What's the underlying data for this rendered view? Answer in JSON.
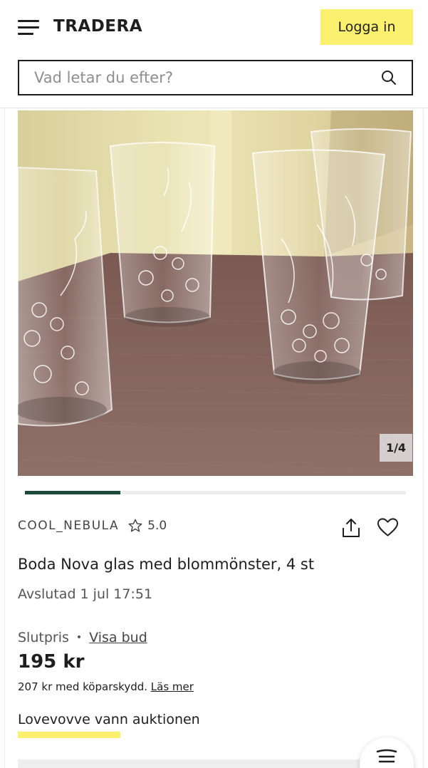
{
  "header": {
    "logo": "TRADERA",
    "login_label": "Logga in",
    "search_placeholder": "Vad letar du efter?"
  },
  "gallery": {
    "counter": "1/4",
    "progress": 0.25
  },
  "listing": {
    "seller": "COOL_NEBULA",
    "rating": "5.0",
    "title": "Boda Nova glas med blommönster, 4 st",
    "ended": "Avslutad 1 jul 17:51",
    "price_label": "Slutpris",
    "bids_link": "Visa bud",
    "price": "195 kr",
    "protection_text": "207 kr med köparskydd.",
    "protection_link": "Läs mer",
    "winner_text": "Lovevovve vann auktionen"
  },
  "colors": {
    "accent_yellow": "#fbf16e",
    "progress_green": "#1c4a3a"
  },
  "icons": [
    "menu-icon",
    "search-icon",
    "star-icon",
    "share-icon",
    "heart-icon",
    "chat-icon"
  ]
}
